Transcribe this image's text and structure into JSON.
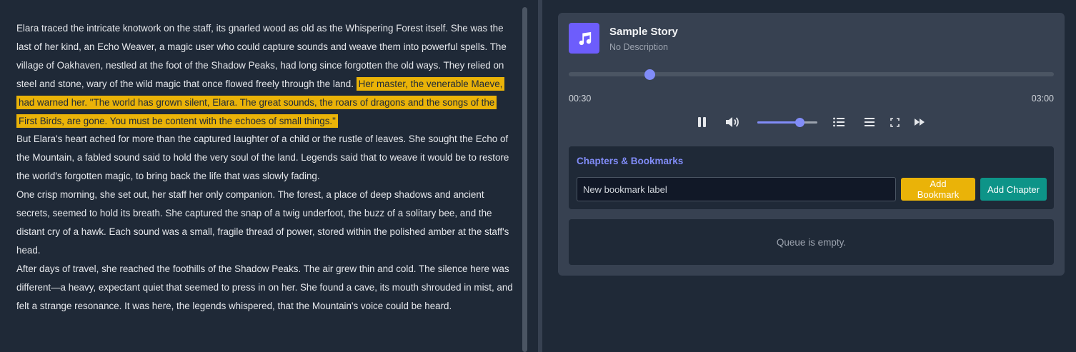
{
  "story": {
    "paragraphs": [
      {
        "text": "Elara traced the intricate knotwork on the staff, its gnarled wood as old as the Whispering Forest itself. She was the last of her kind, an Echo Weaver, a magic user who could capture sounds and weave them into powerful spells. The village of Oakhaven, nestled at the foot of the Shadow Peaks, had long since forgotten the old ways. They relied on steel and stone, wary of the wild magic that once flowed freely through the land.",
        "highlight": "Her master, the venerable Maeve, had warned her. \"The world has grown silent, Elara. The great sounds, the roars of dragons and the songs of the First Birds, are gone. You must be content with the echoes of small things.\""
      },
      {
        "text": "But Elara's heart ached for more than the captured laughter of a child or the rustle of leaves. She sought the Echo of the Mountain, a fabled sound said to hold the very soul of the land. Legends said that to weave it would be to restore the world's forgotten magic, to bring back the life that was slowly fading."
      },
      {
        "text": "One crisp morning, she set out, her staff her only companion. The forest, a place of deep shadows and ancient secrets, seemed to hold its breath. She captured the snap of a twig underfoot, the buzz of a solitary bee, and the distant cry of a hawk. Each sound was a small, fragile thread of power, stored within the polished amber at the staff's head."
      },
      {
        "text": "After days of travel, she reached the foothills of the Shadow Peaks. The air grew thin and cold. The silence here was different—a heavy, expectant quiet that seemed to press in on her. She found a cave, its mouth shrouded in mist, and felt a strange resonance. It was here, the legends whispered, that the Mountain's voice could be heard."
      }
    ]
  },
  "player": {
    "title": "Sample Story",
    "description": "No Description",
    "current_time": "00:30",
    "total_time": "03:00",
    "progress": 0.1667,
    "volume": 0.71,
    "album_icon": "music-note-icon",
    "controls": [
      "pause-icon",
      "volume-icon",
      "list-icon",
      "menu-icon",
      "fullscreen-icon",
      "fast-forward-icon"
    ]
  },
  "chapters": {
    "heading": "Chapters & Bookmarks",
    "input_placeholder": "New bookmark label",
    "input_value": "",
    "add_bookmark_label": "Add Bookmark",
    "add_chapter_label": "Add Chapter"
  },
  "queue": {
    "empty_text": "Queue is empty."
  },
  "colors": {
    "accent": "#818cf8",
    "highlight": "#eab308",
    "album_bg": "#6d5dfc",
    "add_chapter": "#0d9488"
  }
}
